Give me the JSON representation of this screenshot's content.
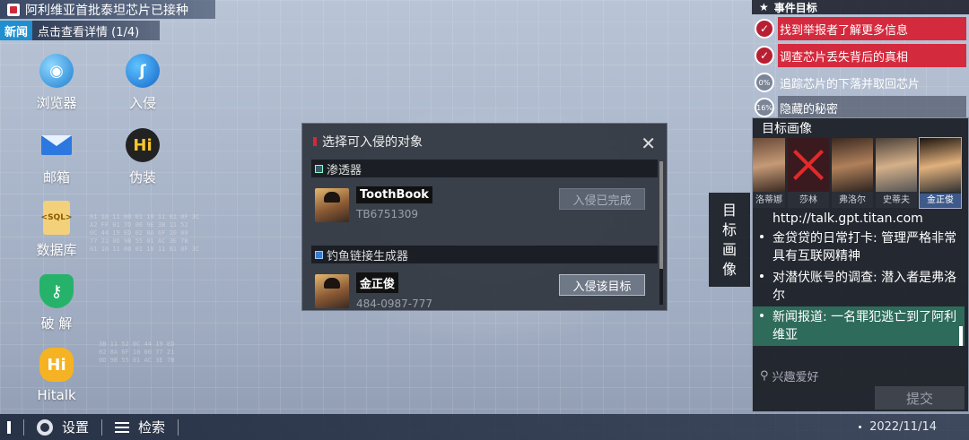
{
  "news": {
    "headline": "阿利维亚首批泰坦芯片已接种",
    "tag": "新闻",
    "text": "点击查看详情 (1/4)"
  },
  "desktop": {
    "icons": [
      {
        "label": "浏览器",
        "icon": "globe-icon"
      },
      {
        "label": "入侵",
        "icon": "hook-icon"
      },
      {
        "label": "邮箱",
        "icon": "mail-icon"
      },
      {
        "label": "伪装",
        "icon": "mask-icon"
      },
      {
        "label": "数据库",
        "icon": "database-icon",
        "glyph": "<SQL>"
      },
      {
        "label": "破 解",
        "icon": "key-shield-icon"
      },
      {
        "label": "Hitalk",
        "icon": "hitalk-icon",
        "glyph": "Hi"
      }
    ]
  },
  "dialog": {
    "title": "选择可入侵的对象",
    "close": "✕",
    "sections": [
      {
        "name": "渗透器",
        "target": {
          "name": "ToothBook",
          "sub": "TB6751309",
          "button": "入侵已完成"
        }
      },
      {
        "name": "钓鱼链接生成器",
        "target": {
          "name": "金正俊",
          "sub": "484-0987-777",
          "button": "入侵该目标"
        }
      }
    ]
  },
  "events": {
    "title": "事件目标",
    "items": [
      {
        "text": "找到举报者了解更多信息",
        "status": "done"
      },
      {
        "text": "调查芯片丢失背后的真相",
        "status": "done"
      },
      {
        "text": "追踪芯片的下落并取回芯片",
        "status": "progress",
        "pct": "0%"
      },
      {
        "text": "隐藏的秘密",
        "status": "progress",
        "pct": "16%"
      }
    ]
  },
  "portrait": {
    "title": "目标画像",
    "faces": [
      {
        "name": "洛蒂娜"
      },
      {
        "name": "莎林"
      },
      {
        "name": "弗洛尔"
      },
      {
        "name": "史蒂夫"
      },
      {
        "name": "金正俊"
      }
    ],
    "url": "http://talk.gpt.titan.com",
    "info": [
      {
        "text": "金贷贷的日常打卡: 管理严格非常具有互联网精神"
      },
      {
        "text": "对潜伏账号的调查: 潜入者是弗洛尔"
      },
      {
        "text": "新闻报道: 一名罪犯逃亡到了阿利维亚"
      }
    ],
    "hobby": "兴趣爱好",
    "submit": "提交"
  },
  "side_tab": [
    "目",
    "标",
    "画",
    "像"
  ],
  "taskbar": {
    "settings": "设置",
    "search": "检索",
    "date": "2022/11/14"
  },
  "colors": {
    "accent_red": "#d42a3e",
    "news_blue": "#1f8fd0",
    "highlight_green": "#2e6b5a"
  }
}
